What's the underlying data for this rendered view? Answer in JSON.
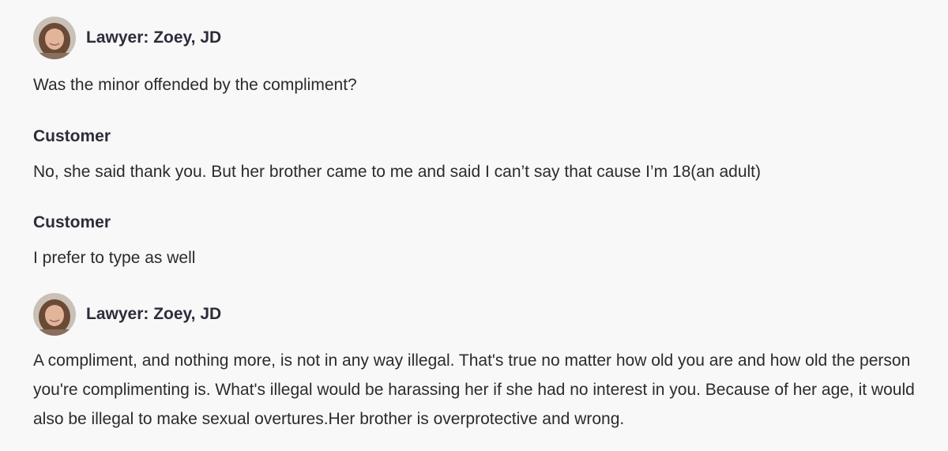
{
  "messages": [
    {
      "role": "lawyer",
      "name": "Lawyer: Zoey, JD",
      "text": "Was the minor offended by the compliment?"
    },
    {
      "role": "customer",
      "name": "Customer",
      "text": "No, she said thank you. But her brother came to me and said I can’t say that cause I’m 18(an adult)"
    },
    {
      "role": "customer",
      "name": "Customer",
      "text": "I prefer to type as well"
    },
    {
      "role": "lawyer",
      "name": "Lawyer: Zoey, JD",
      "text": "A compliment, and nothing more, is not in any way illegal.  That's true no matter how old you are and how old the person you're complimenting is.  What's illegal would be harassing her if she had no interest in you.  Because of her age, it would also be illegal to make sexual overtures.Her brother is overprotective and wrong."
    }
  ],
  "avatar_icon": "lawyer-portrait",
  "colors": {
    "background": "#f8f8f8",
    "name_text": "#2d2d3a",
    "body_text": "#2b2b2b"
  }
}
